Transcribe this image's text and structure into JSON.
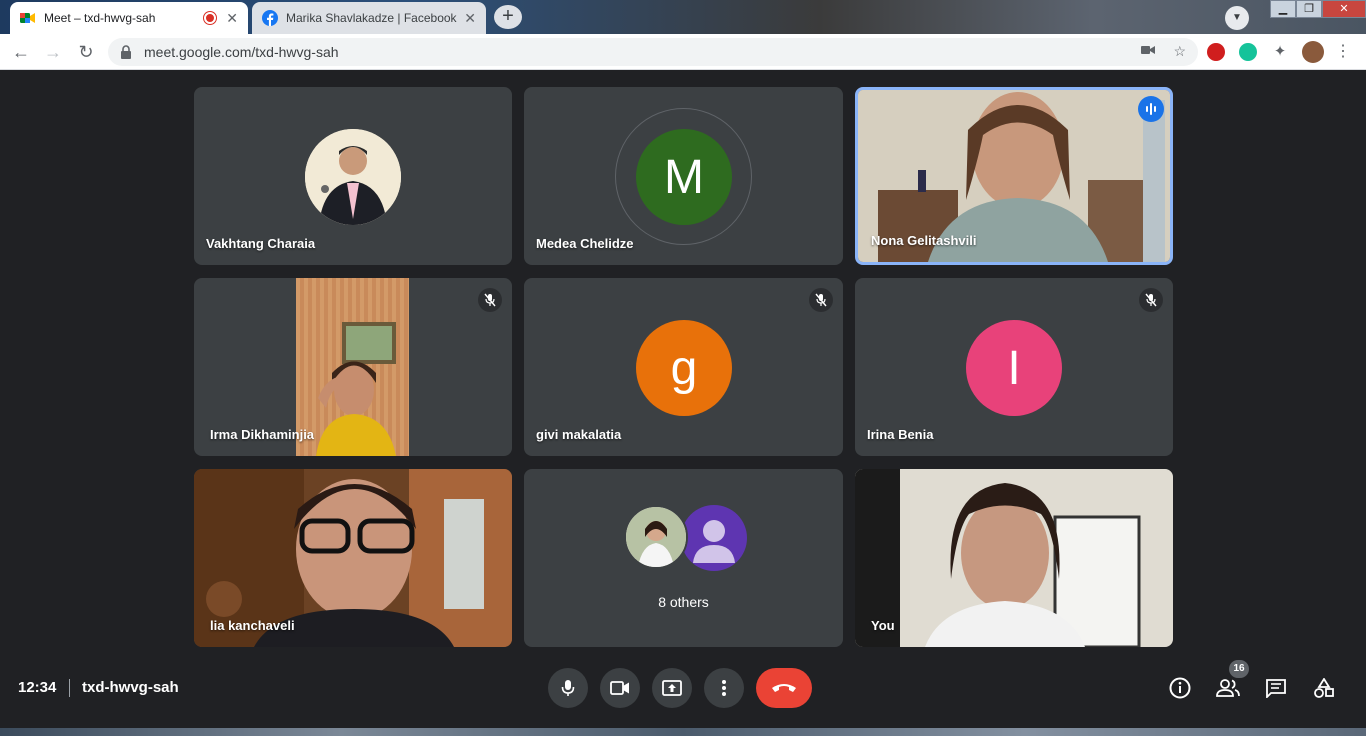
{
  "browser": {
    "tabs": [
      {
        "title": "Meet – txd-hwvg-sah",
        "favicon": "google-meet-icon",
        "recording": true
      },
      {
        "title": "Marika Shavlakadze | Facebook",
        "favicon": "facebook-icon"
      }
    ],
    "url": "meet.google.com/txd-hwvg-sah"
  },
  "participants": [
    {
      "name": "Vakhtang Charaia",
      "type": "photo-avatar"
    },
    {
      "name": "Medea Chelidze",
      "type": "letter-avatar",
      "letter": "M",
      "color": "#2e6b1f"
    },
    {
      "name": "Nona Gelitashvili",
      "type": "video",
      "speaking": true
    },
    {
      "name": "Irma Dikhaminjia",
      "type": "video",
      "muted": true
    },
    {
      "name": "givi makalatia",
      "type": "letter-avatar",
      "letter": "g",
      "color": "#e8710a",
      "muted": true
    },
    {
      "name": "Irina Benia",
      "type": "letter-avatar",
      "letter": "I",
      "color": "#e8427a",
      "muted": true
    },
    {
      "name": "lia kanchaveli",
      "type": "video"
    },
    {
      "name": "",
      "type": "others",
      "others_label": "8 others"
    },
    {
      "name": "You",
      "type": "video"
    }
  ],
  "bottom_bar": {
    "time": "12:34",
    "meeting_code": "txd-hwvg-sah",
    "people_count": "16"
  },
  "colors": {
    "background": "#202124",
    "tile": "#3c4043",
    "end_call": "#ea4335",
    "accent": "#1a73e8"
  }
}
